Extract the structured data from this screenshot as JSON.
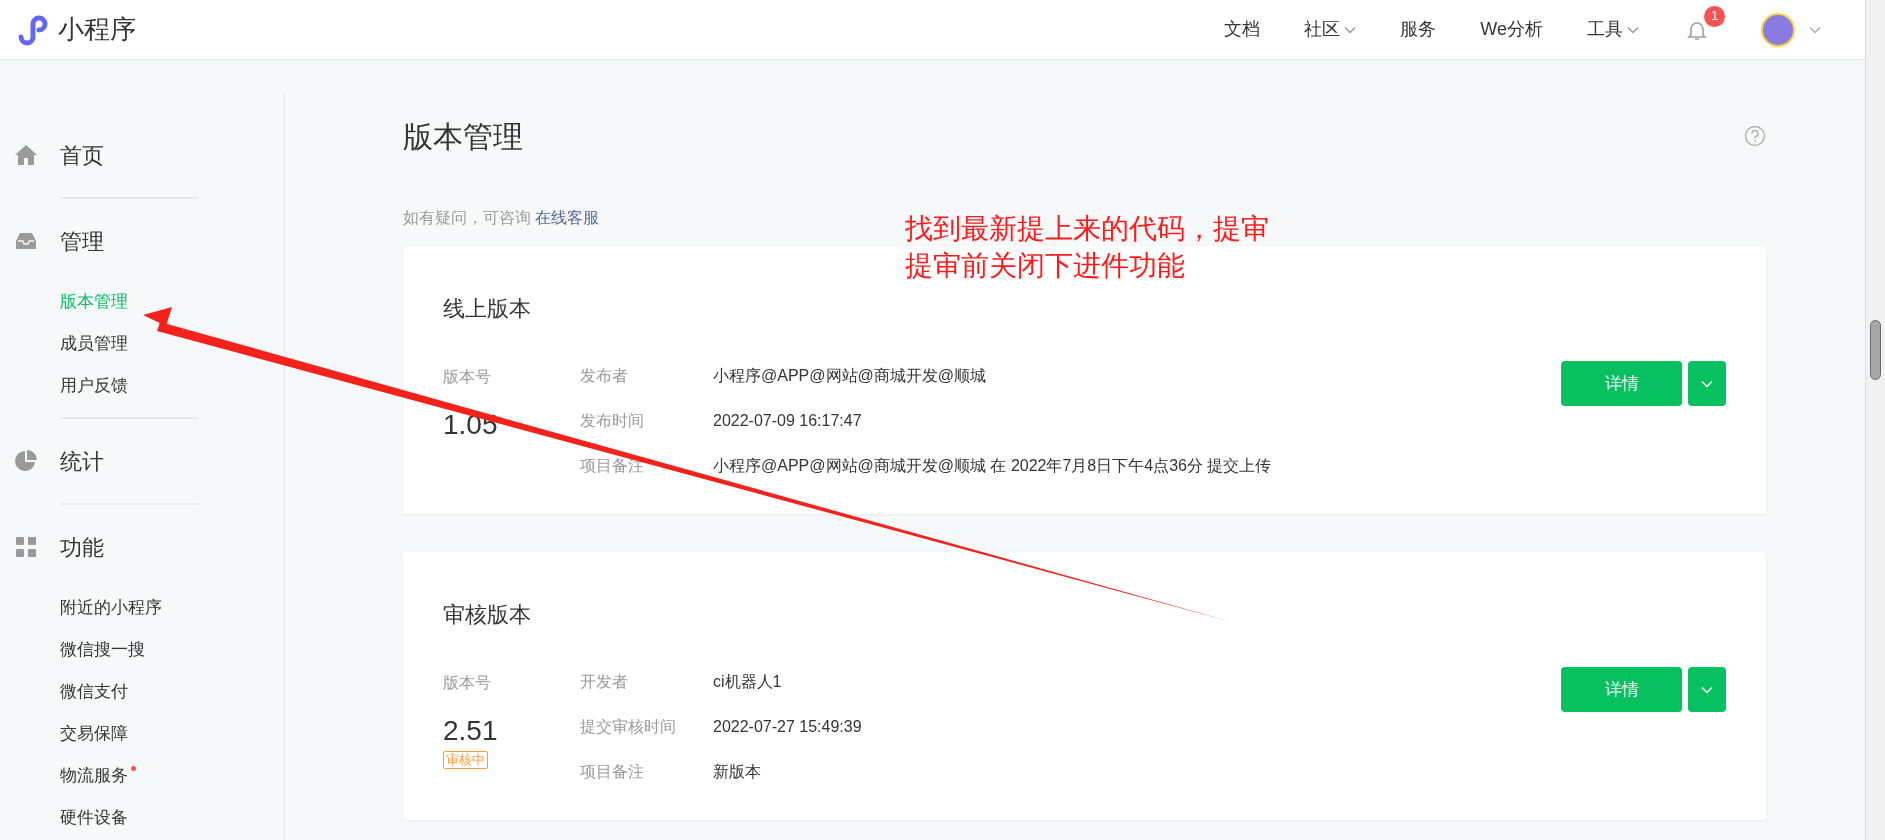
{
  "header": {
    "logo_text": "小程序",
    "nav": [
      {
        "label": "文档",
        "has_caret": false
      },
      {
        "label": "社区",
        "has_caret": true
      },
      {
        "label": "服务",
        "has_caret": false
      },
      {
        "label": "We分析",
        "has_caret": false
      },
      {
        "label": "工具",
        "has_caret": true
      }
    ],
    "notification_count": "1"
  },
  "sidebar": [
    {
      "kind": "home",
      "title": "首页"
    },
    {
      "kind": "manage",
      "title": "管理",
      "children": [
        {
          "label": "版本管理",
          "selected": true,
          "dot": false
        },
        {
          "label": "成员管理",
          "selected": false,
          "dot": false
        },
        {
          "label": "用户反馈",
          "selected": false,
          "dot": false
        }
      ]
    },
    {
      "kind": "stats",
      "title": "统计"
    },
    {
      "kind": "features",
      "title": "功能",
      "children": [
        {
          "label": "附近的小程序",
          "selected": false,
          "dot": false
        },
        {
          "label": "微信搜一搜",
          "selected": false,
          "dot": false
        },
        {
          "label": "微信支付",
          "selected": false,
          "dot": false
        },
        {
          "label": "交易保障",
          "selected": false,
          "dot": false
        },
        {
          "label": "物流服务",
          "selected": false,
          "dot": true
        },
        {
          "label": "硬件设备",
          "selected": false,
          "dot": false
        }
      ]
    }
  ],
  "page": {
    "title": "版本管理",
    "help_text": "如有疑问，可咨询",
    "help_link": "在线客服"
  },
  "annotation": {
    "lines": [
      "找到最新提上来的代码，提审",
      "提审前关闭下进件功能"
    ]
  },
  "cards": [
    {
      "title": "线上版本",
      "version_label": "版本号",
      "version": "1.05",
      "fields": [
        {
          "label": "发布者",
          "value": "小程序@APP@网站@商城开发@顺城"
        },
        {
          "label": "发布时间",
          "value": "2022-07-09 16:17:47"
        },
        {
          "label": "项目备注",
          "value": "小程序@APP@网站@商城开发@顺城 在 2022年7月8日下午4点36分 提交上传"
        }
      ],
      "button": "详情"
    },
    {
      "title": "审核版本",
      "version_label": "版本号",
      "version": "2.51",
      "status": "审核中",
      "fields": [
        {
          "label": "开发者",
          "value": "ci机器人1"
        },
        {
          "label": "提交审核时间",
          "value": "2022-07-27 15:49:39"
        },
        {
          "label": "项目备注",
          "value": "新版本"
        }
      ],
      "button": "详情"
    }
  ]
}
